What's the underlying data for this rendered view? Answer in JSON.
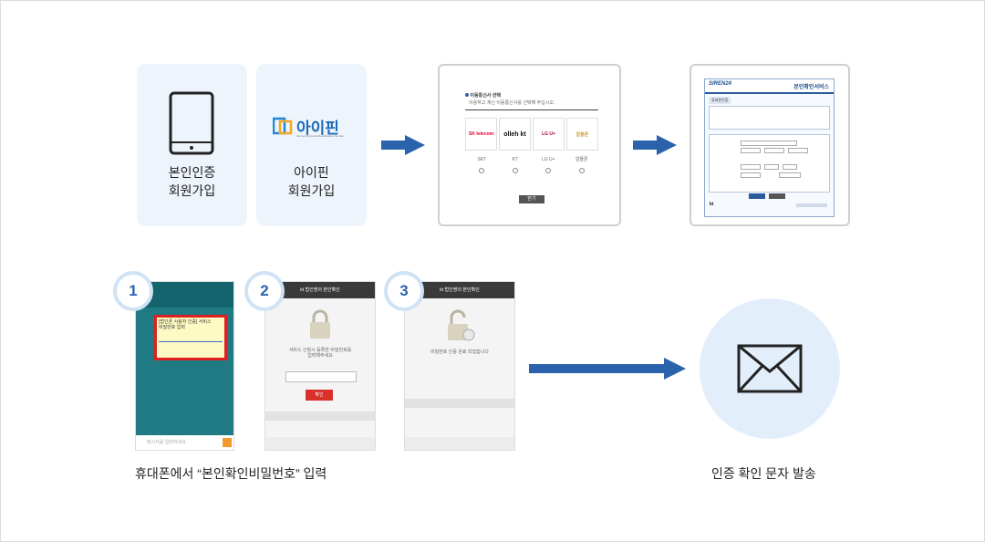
{
  "step_cards": [
    {
      "icon": "tablet-icon",
      "label": "본인인증\n회원가입"
    },
    {
      "logo_text": "아이핀",
      "logo_sub": "Internet Personal Identification Number",
      "label": "아이핀\n회원가입"
    }
  ],
  "carrier_dialog": {
    "title": "이동통신사 선택",
    "subtitle": "이용하고 계신 이동통신사를 선택해 주십시오.",
    "carriers": [
      "SKT",
      "KT",
      "LG U+",
      "알뜰폰"
    ],
    "carrier_logos": [
      "SK telecom",
      "olleh kt",
      "LG U+",
      "알뜰폰"
    ],
    "confirm_label": "닫기"
  },
  "siren_window": {
    "brand": "SIREN24",
    "title": "본인확인서비스",
    "tab": "휴대폰인증",
    "footer_brand": "kt"
  },
  "phones": [
    {
      "number": "1",
      "sms_lines": [
        "[법인폰 사용자 인증] 서비스",
        "비밀번호 입력"
      ],
      "input_placeholder": "메시지를 입력하세요"
    },
    {
      "number": "2",
      "header": "kt 법인명의 본인확인",
      "message": "서비스 신청시 등록한 비밀번호를 입력해주세요",
      "button": "확인"
    },
    {
      "number": "3",
      "header": "kt 법인명의 본인확인",
      "message": "비밀번호 인증 완료 되었습니다"
    }
  ],
  "caption_left": "휴대폰에서 “본인확인비밀번호” 입력",
  "caption_right": "인증 확인 문자 발송",
  "colors": {
    "arrow": "#2a63ac",
    "card_bg": "#eef4fb",
    "circle_bg": "#e3eefb",
    "badge_text": "#2a63ac"
  }
}
